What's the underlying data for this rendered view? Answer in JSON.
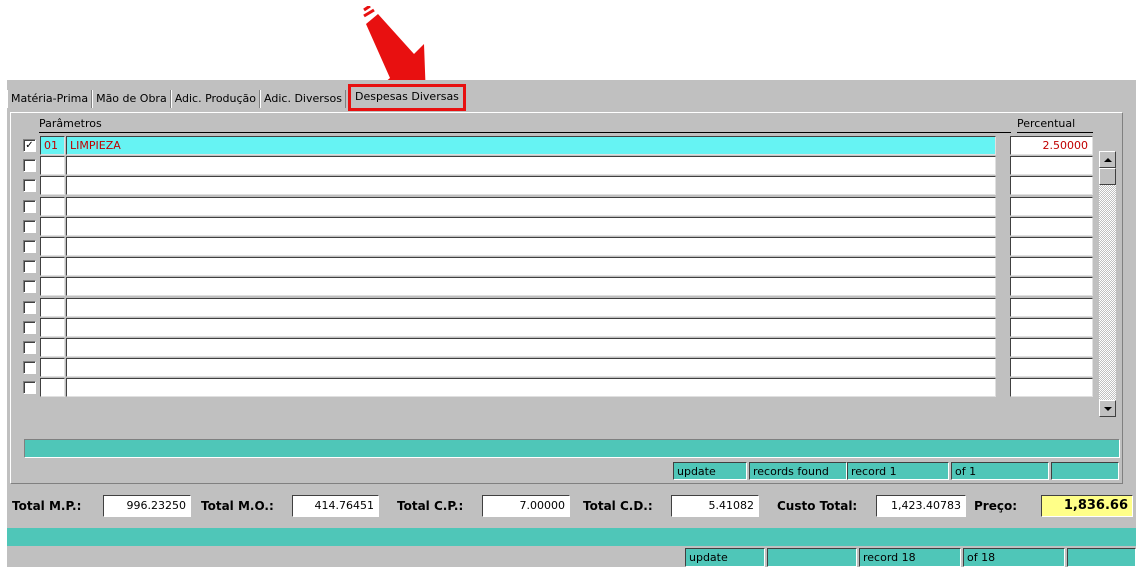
{
  "tabs": [
    {
      "label": "Matéria-Prima"
    },
    {
      "label": "Mão de Obra"
    },
    {
      "label": "Adic. Produção"
    },
    {
      "label": "Adic. Diversos"
    },
    {
      "label": "Despesas Diversas"
    }
  ],
  "active_tab": "Despesas Diversas",
  "grid": {
    "headers": {
      "params": "Parâmetros",
      "percent": "Percentual"
    },
    "rows": [
      {
        "checked": true,
        "code": "01",
        "name": "LIMPIEZA",
        "percent": "2.50000"
      },
      {
        "checked": false,
        "code": "",
        "name": "",
        "percent": ""
      },
      {
        "checked": false,
        "code": "",
        "name": "",
        "percent": ""
      },
      {
        "checked": false,
        "code": "",
        "name": "",
        "percent": ""
      },
      {
        "checked": false,
        "code": "",
        "name": "",
        "percent": ""
      },
      {
        "checked": false,
        "code": "",
        "name": "",
        "percent": ""
      },
      {
        "checked": false,
        "code": "",
        "name": "",
        "percent": ""
      },
      {
        "checked": false,
        "code": "",
        "name": "",
        "percent": ""
      },
      {
        "checked": false,
        "code": "",
        "name": "",
        "percent": ""
      },
      {
        "checked": false,
        "code": "",
        "name": "",
        "percent": ""
      },
      {
        "checked": false,
        "code": "",
        "name": "",
        "percent": ""
      },
      {
        "checked": false,
        "code": "",
        "name": "",
        "percent": ""
      },
      {
        "checked": false,
        "code": "",
        "name": "",
        "percent": ""
      }
    ]
  },
  "panel_status": {
    "mode": "update",
    "records": "records found",
    "record": "record   1",
    "of": "of    1"
  },
  "totals": {
    "mp_label": "Total M.P.:",
    "mp_value": "996.23250",
    "mo_label": "Total M.O.:",
    "mo_value": "414.76451",
    "cp_label": "Total C.P.:",
    "cp_value": "7.00000",
    "cd_label": "Total C.D.:",
    "cd_value": "5.41082",
    "custo_label": "Custo Total:",
    "custo_value": "1,423.40783",
    "preco_label": "Preço:",
    "preco_value": "1,836.66"
  },
  "bottom_status": {
    "mode": "update",
    "records": "",
    "record": "record  18",
    "of": "of   18"
  },
  "colors": {
    "teal": "#4fc6b8",
    "selected_row": "#66f3f3",
    "highlight": "#e81010",
    "preco_bg": "#ffff88"
  }
}
